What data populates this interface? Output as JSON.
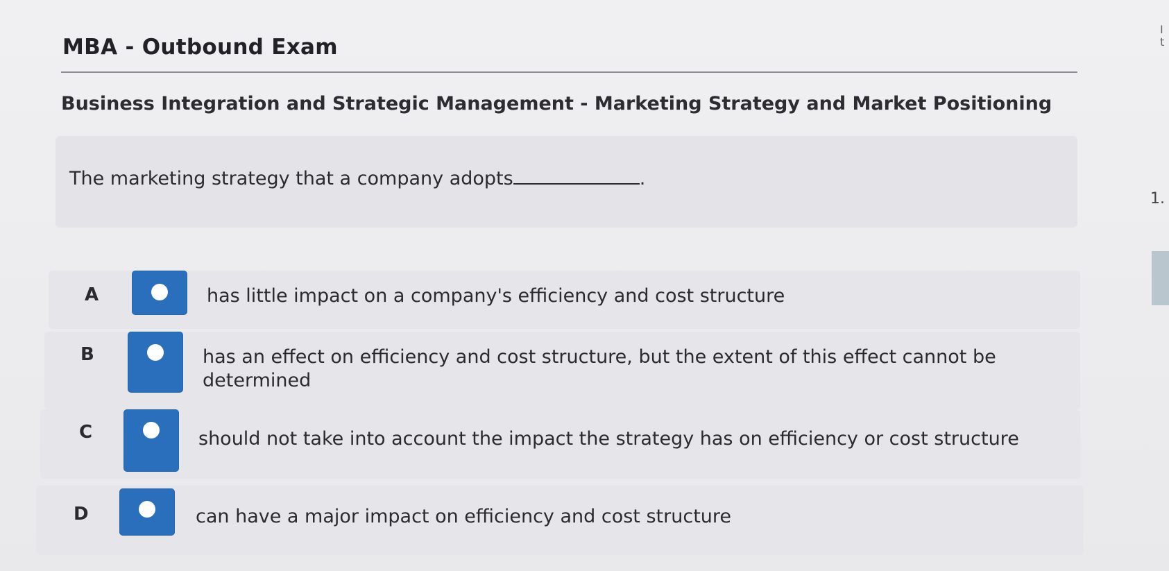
{
  "header": {
    "title": "MBA - Outbound Exam",
    "subtitle": "Business Integration and Strategic Management - Marketing Strategy and Market Positioning"
  },
  "question": {
    "prompt": "The marketing strategy that a company adopts",
    "end_punct": "."
  },
  "options": [
    {
      "letter": "A",
      "text": "has little impact on a company's efficiency and cost structure",
      "selected": false
    },
    {
      "letter": "B",
      "text": "has an effect on efficiency and cost structure, but the extent of this effect cannot be determined",
      "selected": false
    },
    {
      "letter": "C",
      "text": "should not take into account the impact the strategy has on efficiency or cost structure",
      "selected": false
    },
    {
      "letter": "D",
      "text": "can have a major impact on efficiency and cost structure",
      "selected": false
    }
  ],
  "edge": {
    "glyph": "1.",
    "marks": "I\nt"
  },
  "colors": {
    "radio_fill": "#2a6fbb",
    "radio_dot": "#ffffff",
    "option_bg": "#e6e6ea",
    "page_bg": "#ececef"
  }
}
